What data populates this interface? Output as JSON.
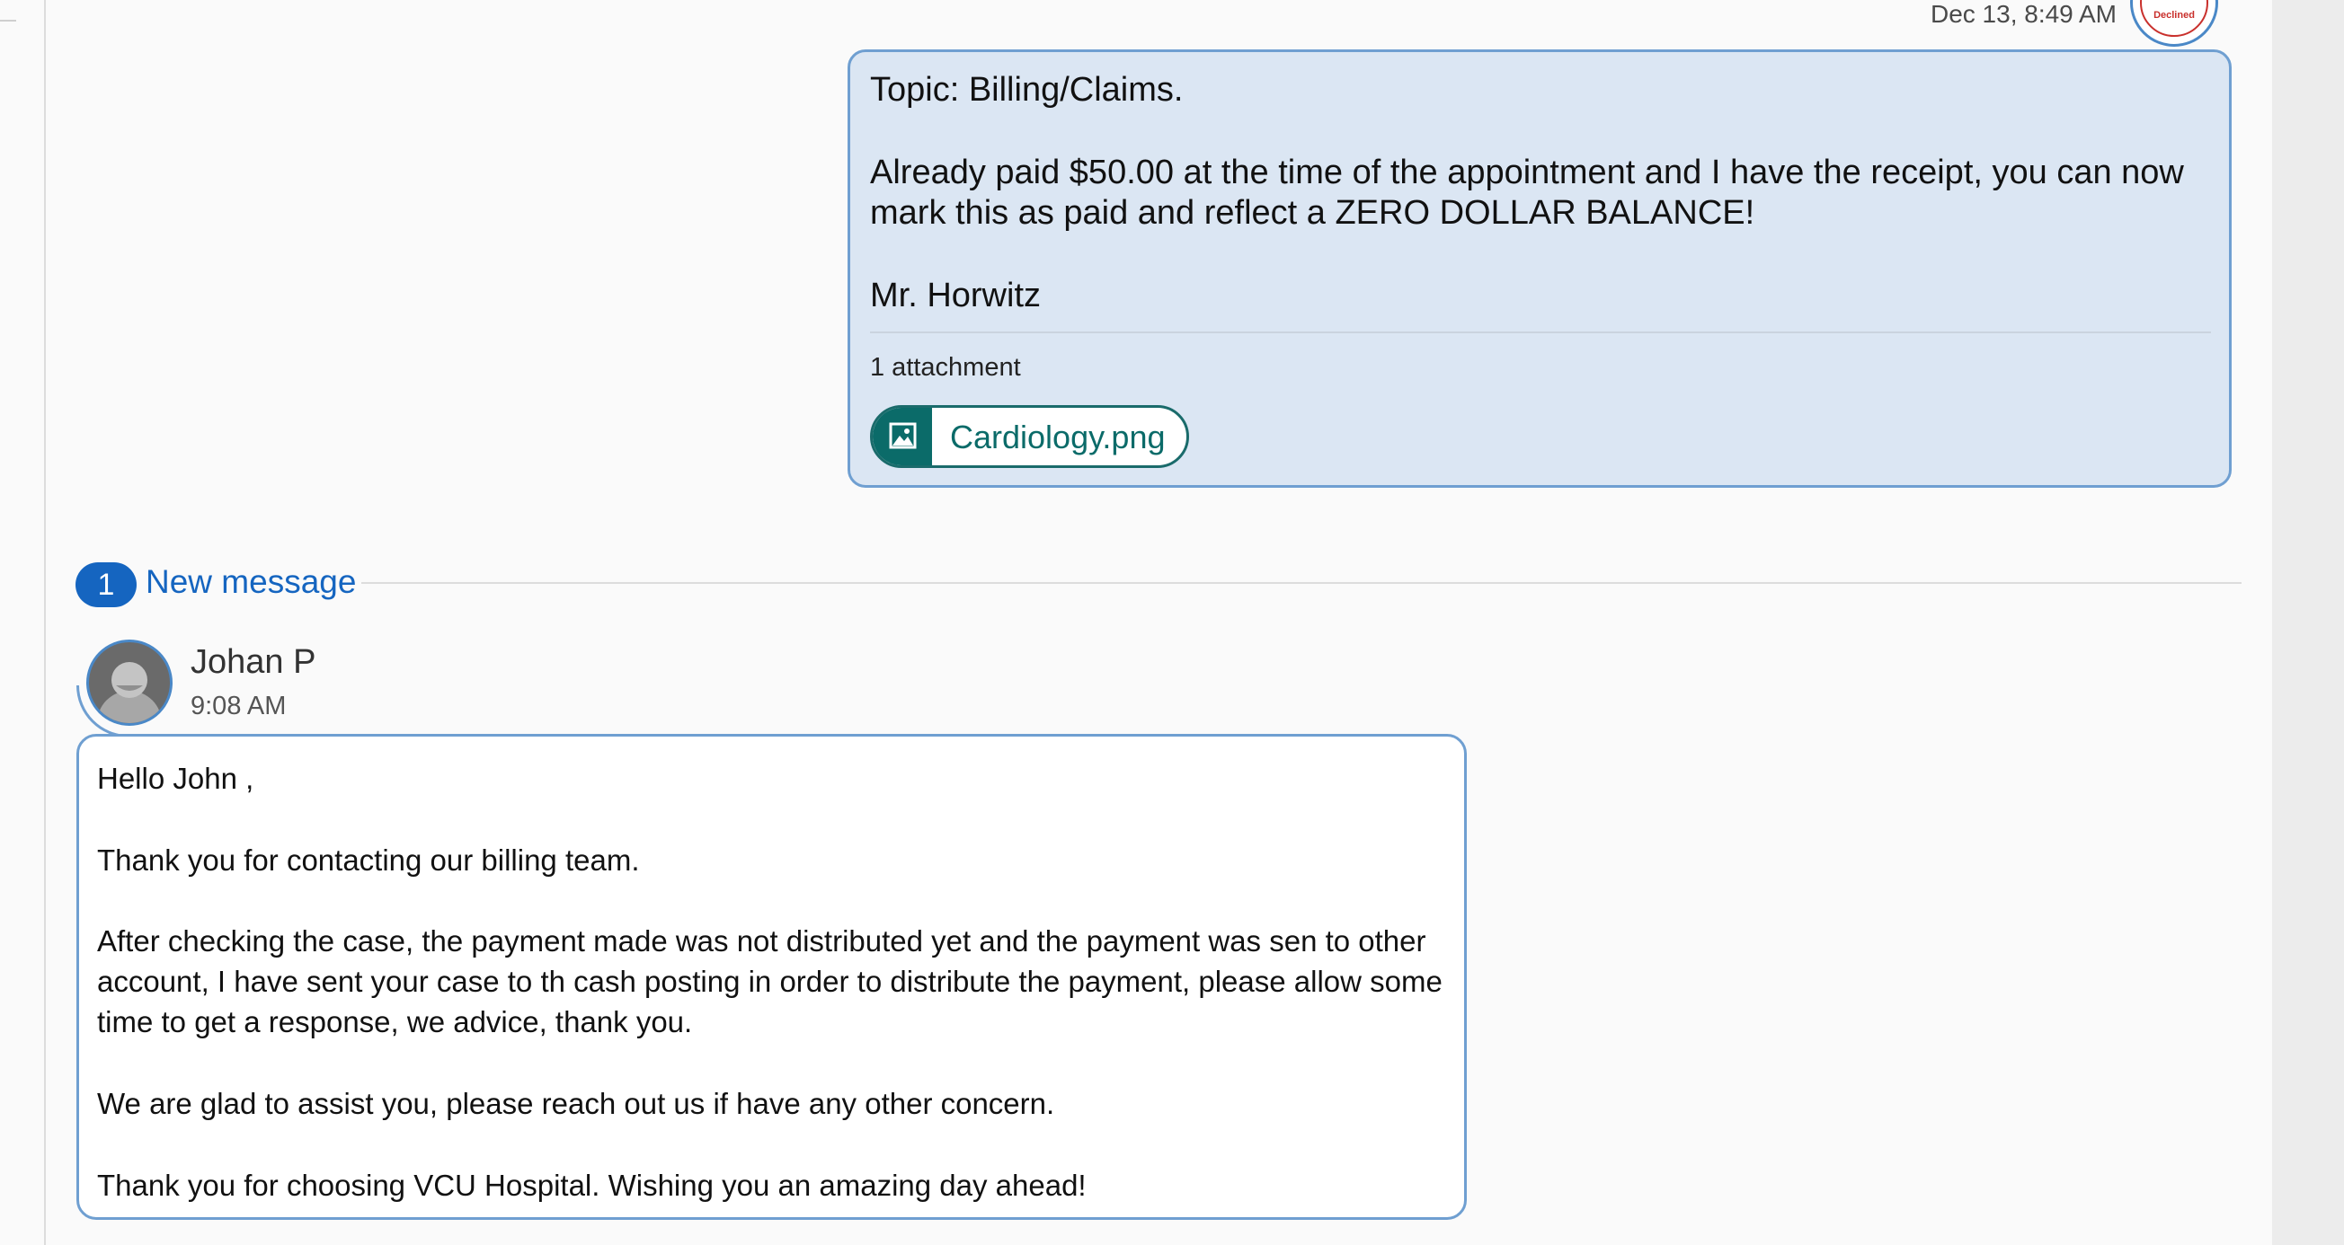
{
  "sent_message": {
    "timestamp": "Dec 13, 8:49 AM",
    "seal_label": "Declined",
    "topic": "Topic: Billing/Claims.",
    "body": "Already paid $50.00 at the time of the appointment and I have the receipt, you can now\nmark this as paid and reflect a ZERO DOLLAR BALANCE!",
    "signature": "Mr. Horwitz",
    "attachment_count": "1 attachment",
    "attachment_name": "Cardiology.png",
    "attachment_icon": "image-icon"
  },
  "new_messages": {
    "count": "1",
    "label": "New message"
  },
  "received_message": {
    "sender": "Johan P",
    "avatar_icon": "person-avatar-icon",
    "timestamp": "9:08 AM",
    "greeting": "Hello John ,",
    "para1": "Thank you for contacting our billing team.",
    "para2_line1": "After checking the case, the payment made was not distributed yet and the payment was sen to other",
    "para2_line2": "account, I have sent your case to th cash posting in order to distribute the payment, please allow some",
    "para2_line3": "time to get a response, we advice, thank you.",
    "para3": "We are glad to assist you, please reach out us if have any other concern.",
    "para4": "Thank you for choosing VCU Hospital. Wishing you an amazing day ahead!"
  },
  "colors": {
    "sent_bubble": "#dbe6f3",
    "bubble_border": "#6f9fd1",
    "accent_blue": "#1565c0",
    "attachment_teal": "#0b6b69"
  }
}
